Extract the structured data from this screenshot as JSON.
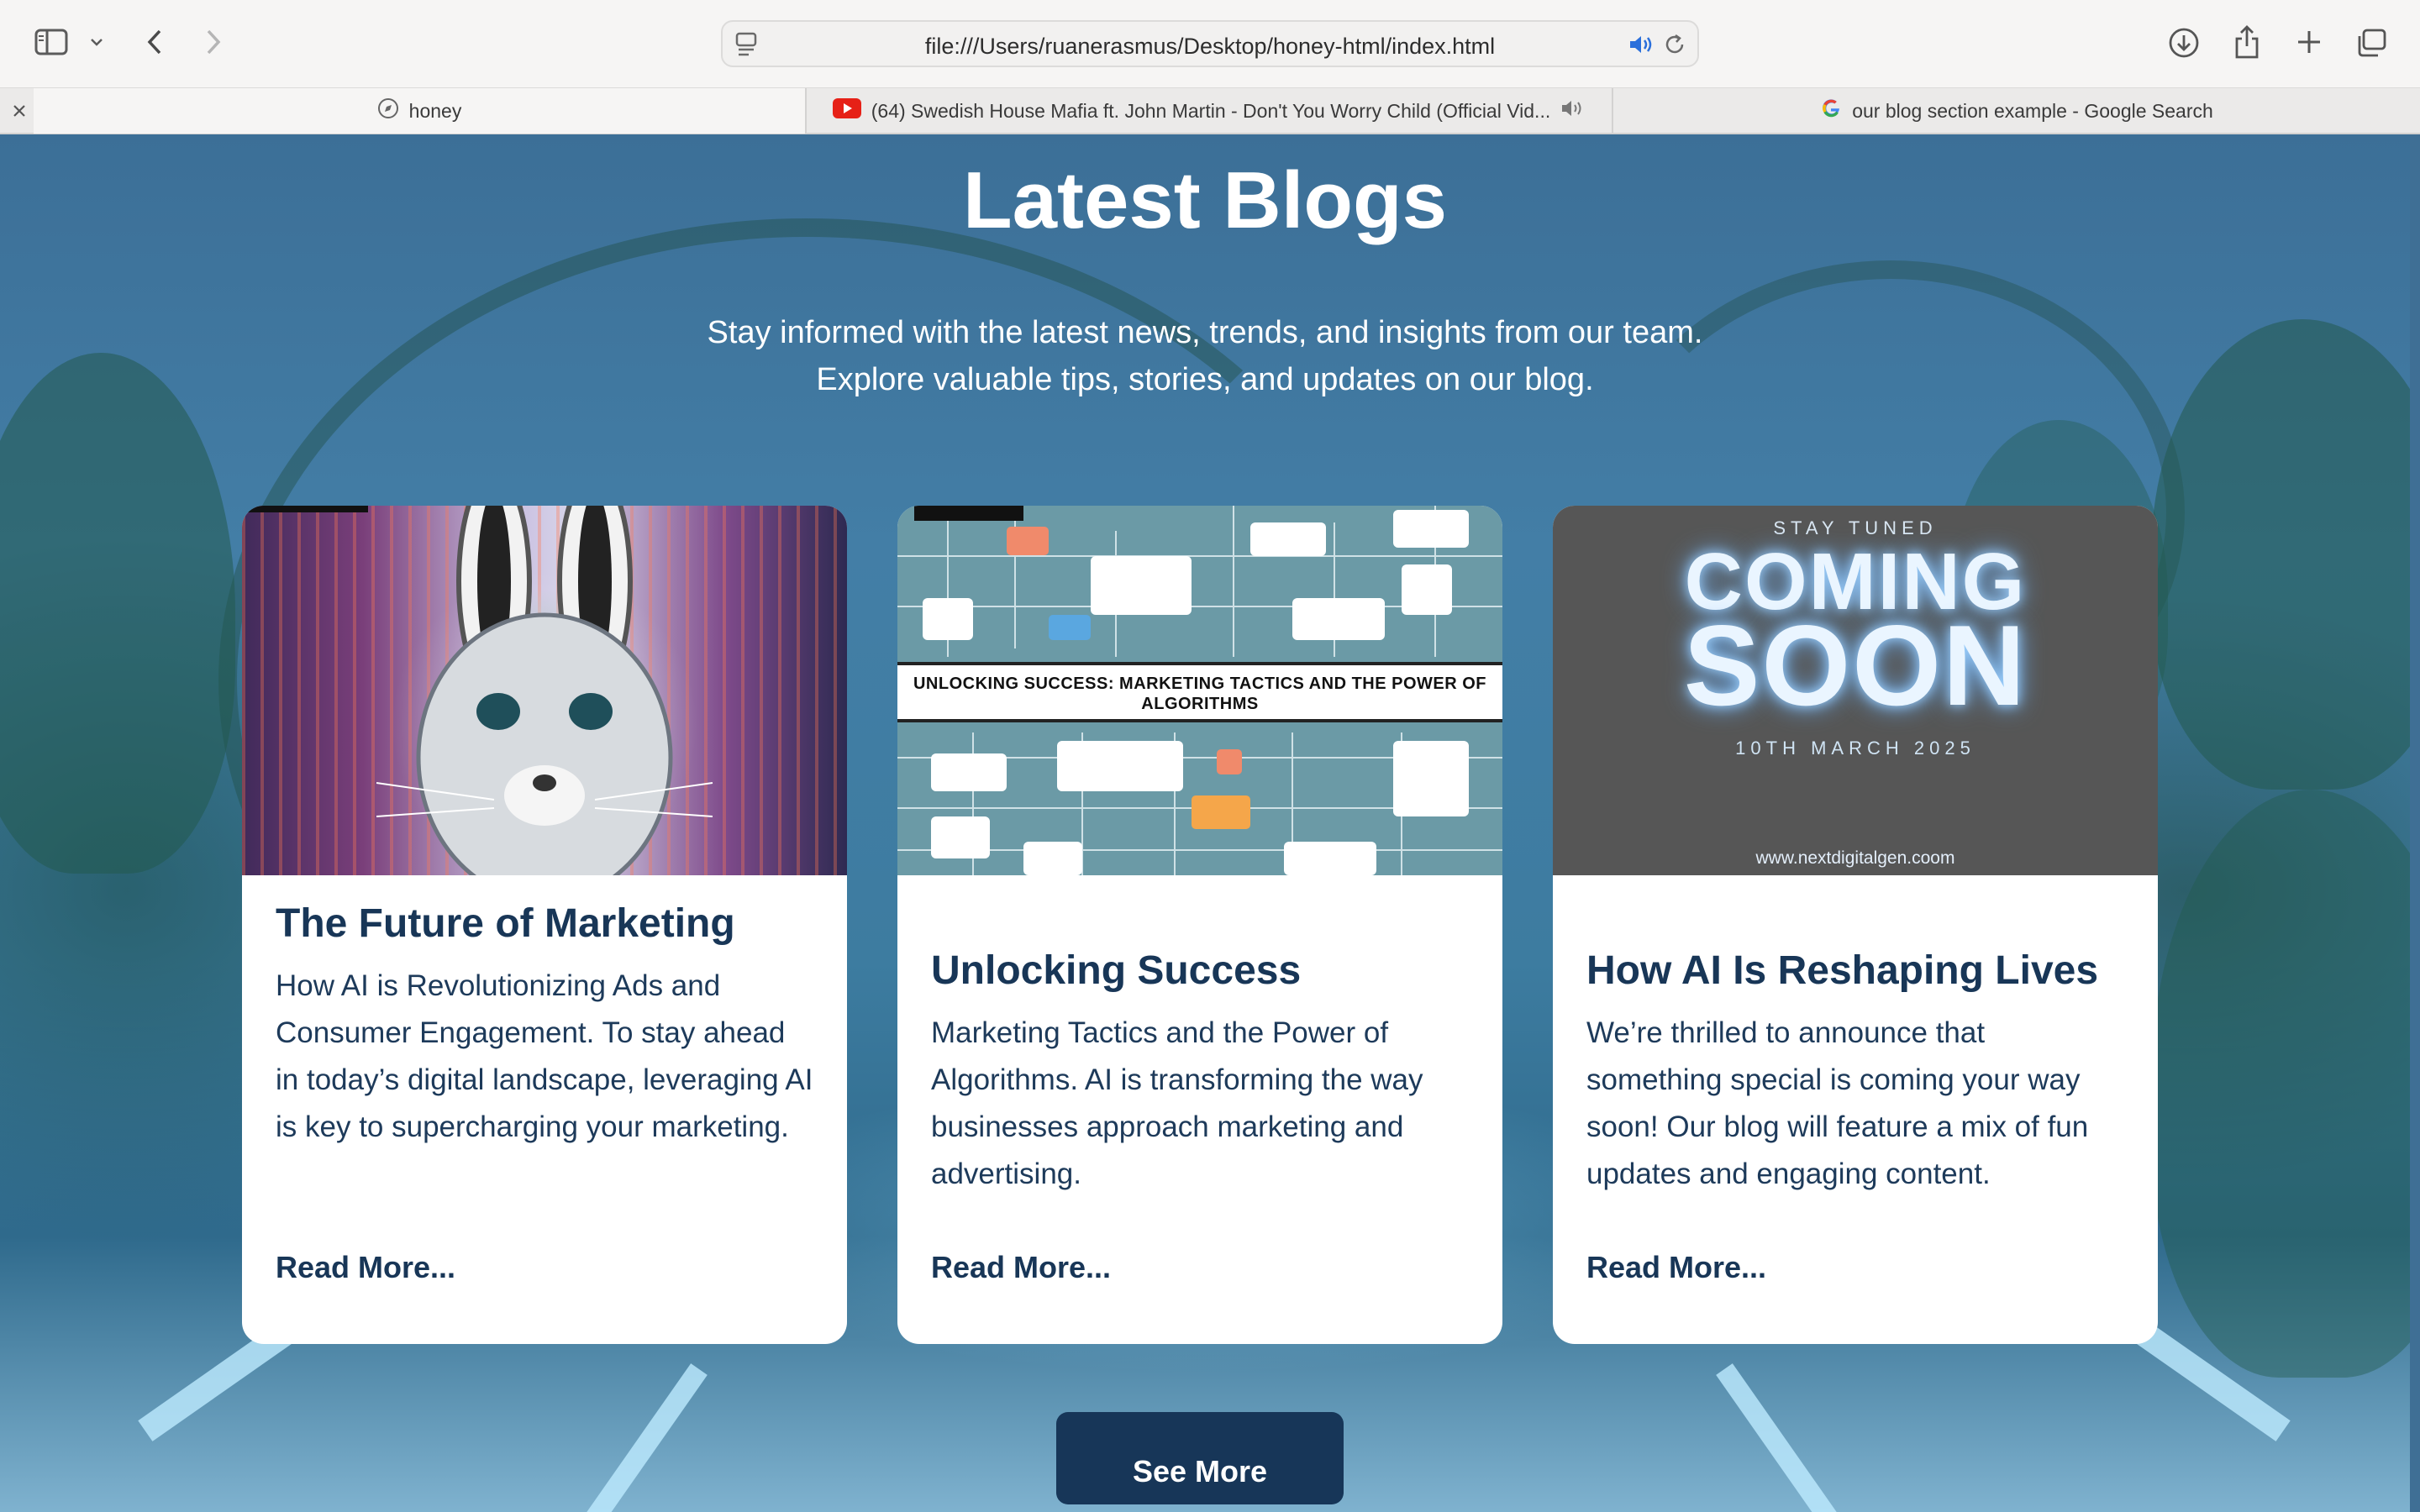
{
  "browser": {
    "url": "file:///Users/ruanerasmus/Desktop/honey-html/index.html",
    "tabs": [
      {
        "label": "honey"
      },
      {
        "label": "(64) Swedish House Mafia ft. John Martin - Don't You Worry Child (Official Vid..."
      },
      {
        "label": "our blog section example - Google Search"
      }
    ]
  },
  "section": {
    "title": "Latest Blogs",
    "subtitle_line1": "Stay informed with the latest news, trends, and insights from our team.",
    "subtitle_line2": "Explore valuable tips, stories, and updates on our blog."
  },
  "cards": [
    {
      "title": "The Future of Marketing",
      "text": "How AI is Revolutionizing Ads and Consumer Engagement. To stay ahead in today’s digital landscape, leveraging AI is key to supercharging your marketing.",
      "read_more": "Read More..."
    },
    {
      "title": "Unlocking Success",
      "text": "Marketing Tactics and the Power of Algorithms. AI is transforming the way businesses approach marketing and advertising.",
      "read_more": "Read More...",
      "image_banner": "UNLOCKING SUCCESS: MARKETING TACTICS AND THE POWER OF ALGORITHMS"
    },
    {
      "title": "How AI Is Reshaping Lives",
      "text": "We’re thrilled to announce that something special is coming your way soon! Our blog will feature a mix of fun updates and engaging content.",
      "read_more": "Read More...",
      "image_top": "STAY TUNED",
      "image_line1": "COMING",
      "image_line2": "SOON",
      "image_date": "10TH MARCH 2025",
      "image_url": "www.nextdigitalgen.coom"
    }
  ],
  "see_more": "See More",
  "colors": {
    "accent": "#173658",
    "heading": "#183657",
    "page_bg": "#3d6f96"
  }
}
